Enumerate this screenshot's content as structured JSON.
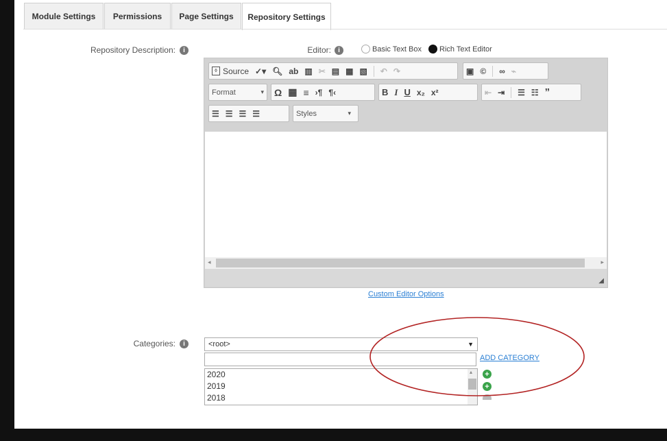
{
  "tabs": [
    {
      "label": "Module Settings"
    },
    {
      "label": "Permissions"
    },
    {
      "label": "Page Settings"
    },
    {
      "label": "Repository Settings"
    }
  ],
  "description": {
    "label": "Repository Description:"
  },
  "editor": {
    "label": "Editor:",
    "options": [
      {
        "label": "Basic Text Box",
        "selected": false
      },
      {
        "label": "Rich Text Editor",
        "selected": true
      }
    ],
    "toolbar": {
      "source_label": "Source",
      "format_label": "Format",
      "styles_label": "Styles"
    },
    "custom_options_link": "Custom Editor Options"
  },
  "categories": {
    "label": "Categories:",
    "selected": "<root>",
    "new_category_value": "",
    "add_link": "ADD CATEGORY",
    "items": [
      {
        "label": "2020"
      },
      {
        "label": "2019"
      },
      {
        "label": "2018"
      }
    ]
  },
  "colors": {
    "annotation": "#b22222",
    "link": "#2a7fd4",
    "add_icon": "#3aa34a"
  }
}
